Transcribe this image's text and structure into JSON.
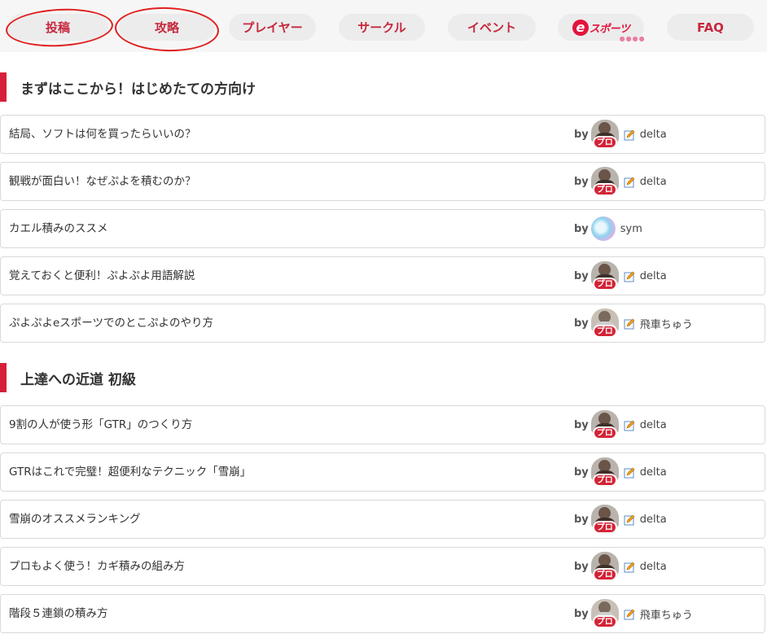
{
  "nav": {
    "tabs": [
      {
        "label": "投稿"
      },
      {
        "label": "攻略"
      },
      {
        "label": "プレイヤー"
      },
      {
        "label": "サークル"
      },
      {
        "label": "イベント"
      },
      {
        "label": "eスポーツ"
      },
      {
        "label": "FAQ"
      }
    ],
    "esports_logo": {
      "e": "e",
      "text": "スポーツ",
      "dots": "●●●●"
    }
  },
  "sections": [
    {
      "title": "まずはここから！はじめたての方向け",
      "rows": [
        {
          "title": "結局、ソフトは何を買ったらいいの？",
          "by": "by",
          "author": "delta",
          "badge": "プロ"
        },
        {
          "title": "観戦が面白い！なぜぷよを積むのか？",
          "by": "by",
          "author": "delta",
          "badge": "プロ"
        },
        {
          "title": "カエル積みのススメ",
          "by": "by",
          "author": "sym",
          "badge": ""
        },
        {
          "title": "覚えておくと便利！ぷよぷよ用語解説",
          "by": "by",
          "author": "delta",
          "badge": "プロ"
        },
        {
          "title": "ぷよぷよeスポーツでのとこぷよのやり方",
          "by": "by",
          "author": "飛車ちゅう",
          "badge": "プロ"
        }
      ]
    },
    {
      "title": "上達への近道 初級",
      "rows": [
        {
          "title": "9割の人が使う形「GTR」のつくり方",
          "by": "by",
          "author": "delta",
          "badge": "プロ"
        },
        {
          "title": "GTRはこれで完璧！超便利なテクニック「雪崩」",
          "by": "by",
          "author": "delta",
          "badge": "プロ"
        },
        {
          "title": "雪崩のオススメランキング",
          "by": "by",
          "author": "delta",
          "badge": "プロ"
        },
        {
          "title": "プロもよく使う！カギ積みの組み方",
          "by": "by",
          "author": "delta",
          "badge": "プロ"
        },
        {
          "title": "階段５連鎖の積み方",
          "by": "by",
          "author": "飛車ちゅう",
          "badge": "プロ"
        }
      ]
    }
  ],
  "colors": {
    "accent": "#c6283d",
    "section_bar": "#d6203a",
    "annotation": "#e02020"
  }
}
